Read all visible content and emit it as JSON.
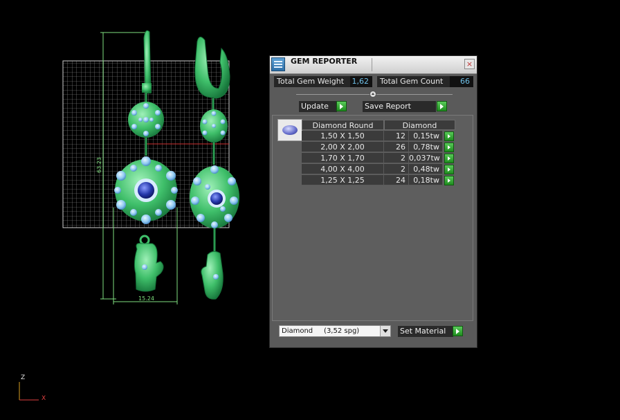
{
  "window": {
    "title": "GEM REPORTER",
    "close_label": "×"
  },
  "totals": {
    "weight_label": "Total Gem Weight",
    "weight_value": "1,62",
    "count_label": "Total Gem Count",
    "count_value": "66"
  },
  "actions": {
    "update_label": "Update",
    "save_report_label": "Save Report"
  },
  "table": {
    "shape_header": "Diamond Round",
    "material_header": "Diamond",
    "rows": [
      {
        "size": "1,50 X 1,50",
        "count": "12",
        "weight": "0,15tw"
      },
      {
        "size": "2,00 X 2,00",
        "count": "26",
        "weight": "0,78tw"
      },
      {
        "size": "1,70 X 1,70",
        "count": "2",
        "weight": "0,037tw"
      },
      {
        "size": "4,00 X 4,00",
        "count": "2",
        "weight": "0,48tw"
      },
      {
        "size": "1,25 X 1,25",
        "count": "24",
        "weight": "0,18tw"
      }
    ]
  },
  "material": {
    "selected": "Diamond     (3,52 spg)",
    "set_label": "Set Material"
  },
  "viewport": {
    "dim_height": "63.23",
    "dim_width": "15.24",
    "axis_z": "Z",
    "axis_x": "X",
    "colors": {
      "background": "#000000",
      "metal": "#3fbf6a",
      "dimension": "#7fe07f",
      "grid": "#bdbdbd",
      "axis_x": "#e04040",
      "gem_light": "#8ec8f0",
      "gem_dark": "#2336a8"
    }
  },
  "icons": [
    "app-icon",
    "close-icon",
    "play-arrow-icon",
    "gem-thumbnail-icon",
    "dropdown-caret-icon"
  ]
}
